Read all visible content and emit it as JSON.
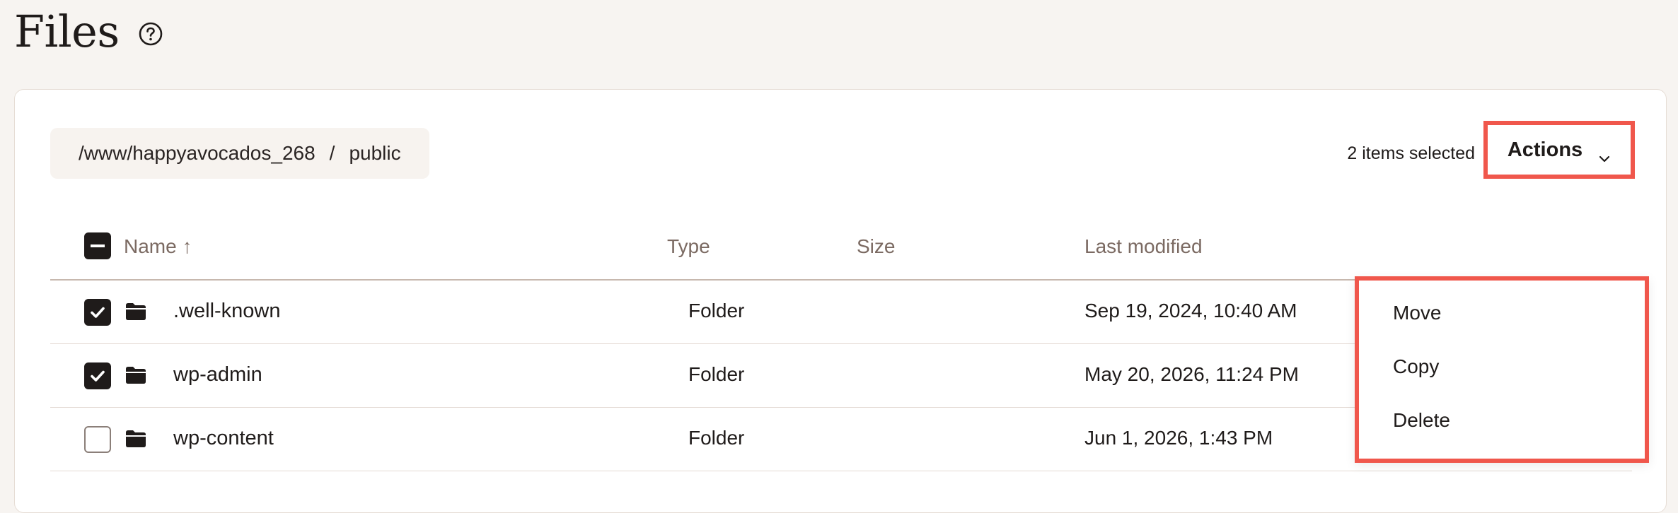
{
  "page": {
    "title": "Files"
  },
  "breadcrumb": {
    "root": "/www/happyavocados_268",
    "separator": "/",
    "current": "public"
  },
  "toolbar": {
    "selected_count": "2 items selected",
    "actions_label": "Actions"
  },
  "table": {
    "columns": {
      "name": "Name ↑",
      "type": "Type",
      "size": "Size",
      "modified": "Last modified"
    },
    "rows": [
      {
        "name": ".well-known",
        "type": "Folder",
        "modified": "Sep 19, 2024, 10:40 AM",
        "checked": true
      },
      {
        "name": "wp-admin",
        "type": "Folder",
        "modified": "May 20, 2026, 11:24 PM",
        "checked": true
      },
      {
        "name": "wp-content",
        "type": "Folder",
        "modified": "Jun 1, 2026, 1:43 PM",
        "checked": false
      }
    ]
  },
  "actions_menu": {
    "items": [
      "Move",
      "Copy",
      "Delete"
    ]
  },
  "colors": {
    "highlight": "#f0574c",
    "background": "#f7f4f1",
    "checkbox": "#1f1b1a"
  },
  "icons": [
    "help-circle-icon",
    "chevron-down-icon",
    "folder-icon",
    "checkmark-icon",
    "minus-icon",
    "more-vertical-icon"
  ]
}
